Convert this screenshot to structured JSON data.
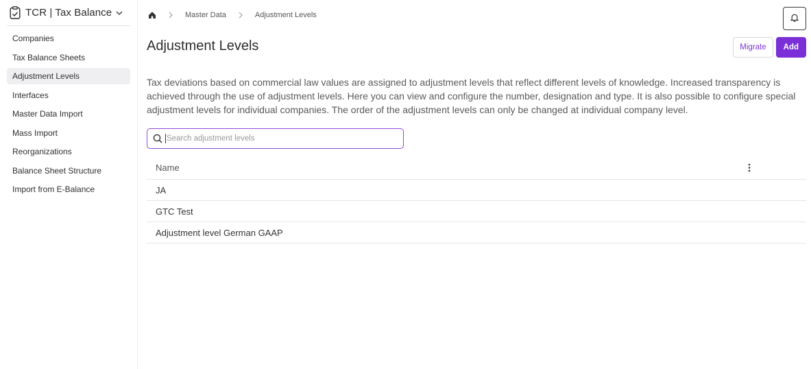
{
  "app": {
    "title": "TCR | Tax Balance",
    "icon": "clipboard-icon"
  },
  "sidebar": {
    "items": [
      {
        "label": "Companies"
      },
      {
        "label": "Tax Balance Sheets"
      },
      {
        "label": "Adjustment Levels",
        "active": true
      },
      {
        "label": "Interfaces"
      },
      {
        "label": "Master Data Import"
      },
      {
        "label": "Mass Import"
      },
      {
        "label": "Reorganizations"
      },
      {
        "label": "Balance Sheet Structure"
      },
      {
        "label": "Import from E-Balance"
      }
    ]
  },
  "breadcrumb": {
    "home_icon": "home-icon",
    "items": [
      "Master Data",
      "Adjustment Levels"
    ]
  },
  "header": {
    "title": "Adjustment Levels",
    "migrate_label": "Migrate",
    "add_label": "Add",
    "notification_icon": "bell-icon"
  },
  "description": "Tax deviations based on commercial law values are assigned to adjustment levels that reflect different levels of knowledge. Increased transparency is achieved through the use of adjustment levels. Here you can view and configure the number, designation and type. It is also possible to configure special adjustment levels for individual companies. The order of the adjustment levels can only be changed at individual company level.",
  "search": {
    "placeholder": "Search adjustment levels",
    "value": ""
  },
  "table": {
    "columns": [
      "Name"
    ],
    "rows": [
      "JA",
      "GTC Test",
      "Adjustment level German GAAP"
    ]
  },
  "colors": {
    "accent": "#7b2fd6",
    "search_border": "#8a4bd8"
  }
}
